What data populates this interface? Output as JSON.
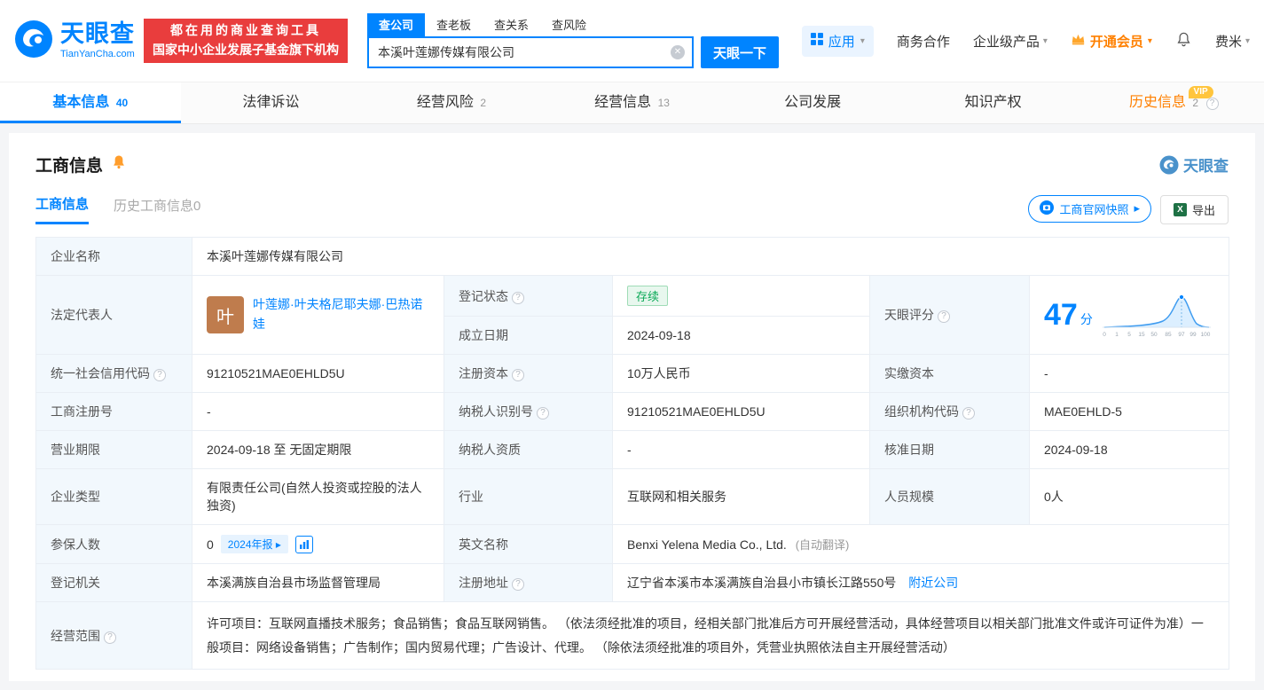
{
  "brand": {
    "name": "天眼查",
    "domain": "TianYanCha.com",
    "slogan_line1": "都在用的商业查询工具",
    "slogan_line2": "国家中小企业发展子基金旗下机构"
  },
  "search": {
    "tabs": [
      {
        "label": "查公司"
      },
      {
        "label": "查老板"
      },
      {
        "label": "查关系"
      },
      {
        "label": "查风险"
      }
    ],
    "value": "本溪叶莲娜传媒有限公司",
    "button": "天眼一下"
  },
  "top_nav": {
    "apps": "应用",
    "cooperation": "商务合作",
    "enterprise": "企业级产品",
    "vip": "开通会员",
    "user": "费米"
  },
  "tabs": [
    {
      "label": "基本信息",
      "count": "40"
    },
    {
      "label": "法律诉讼",
      "count": ""
    },
    {
      "label": "经营风险",
      "count": "2"
    },
    {
      "label": "经营信息",
      "count": "13"
    },
    {
      "label": "公司发展",
      "count": ""
    },
    {
      "label": "知识产权",
      "count": ""
    },
    {
      "label": "历史信息",
      "count": "2",
      "vip_tag": "VIP"
    }
  ],
  "section": {
    "title": "工商信息",
    "watermark": "天眼查",
    "subtab_current": "工商信息",
    "subtab_history": "历史工商信息0",
    "snapshot_button": "工商官网快照",
    "export_button": "导出"
  },
  "info": {
    "company_name_label": "企业名称",
    "company_name": "本溪叶莲娜传媒有限公司",
    "legal_rep_label": "法定代表人",
    "legal_rep_avatar_char": "叶",
    "legal_rep_name": "叶莲娜·叶夫格尼耶夫娜·巴热诺娃",
    "reg_status_label": "登记状态",
    "reg_status_value": "存续",
    "establish_label": "成立日期",
    "establish_value": "2024-09-18",
    "score_label": "天眼评分",
    "score_value": "47",
    "score_unit": "分",
    "credit_code_label": "统一社会信用代码",
    "credit_code_value": "91210521MAE0EHLD5U",
    "reg_capital_label": "注册资本",
    "reg_capital_value": "10万人民币",
    "paid_capital_label": "实缴资本",
    "paid_capital_value": "-",
    "reg_number_label": "工商注册号",
    "reg_number_value": "-",
    "taxpayer_id_label": "纳税人识别号",
    "taxpayer_id_value": "91210521MAE0EHLD5U",
    "org_code_label": "组织机构代码",
    "org_code_value": "MAE0EHLD-5",
    "business_term_label": "营业期限",
    "business_term_value": "2024-09-18 至 无固定期限",
    "taxpayer_quality_label": "纳税人资质",
    "taxpayer_quality_value": "-",
    "approval_date_label": "核准日期",
    "approval_date_value": "2024-09-18",
    "company_type_label": "企业类型",
    "company_type_value": "有限责任公司(自然人投资或控股的法人独资)",
    "industry_label": "行业",
    "industry_value": "互联网和相关服务",
    "staff_size_label": "人员规模",
    "staff_size_value": "0人",
    "insured_label": "参保人数",
    "insured_value": "0",
    "insured_tag": "2024年报",
    "english_name_label": "英文名称",
    "english_name_value": "Benxi Yelena Media Co., Ltd.",
    "english_name_note": "(自动翻译)",
    "registry_label": "登记机关",
    "registry_value": "本溪满族自治县市场监督管理局",
    "address_label": "注册地址",
    "address_value": "辽宁省本溪市本溪满族自治县小市镇长江路550号",
    "address_link": "附近公司",
    "scope_label": "经营范围",
    "scope_value": "许可项目：互联网直播技术服务；食品销售；食品互联网销售。 （依法须经批准的项目，经相关部门批准后方可开展经营活动，具体经营项目以相关部门批准文件或许可证件为准）一般项目：网络设备销售；广告制作；国内贸易代理；广告设计、代理。 （除依法须经批准的项目外，凭营业执照依法自主开展经营活动）"
  },
  "score_chart": {
    "type": "area",
    "score": 47,
    "x_ticks": [
      "0",
      "1",
      "5",
      "15",
      "50",
      "85",
      "97",
      "99",
      "100"
    ]
  }
}
